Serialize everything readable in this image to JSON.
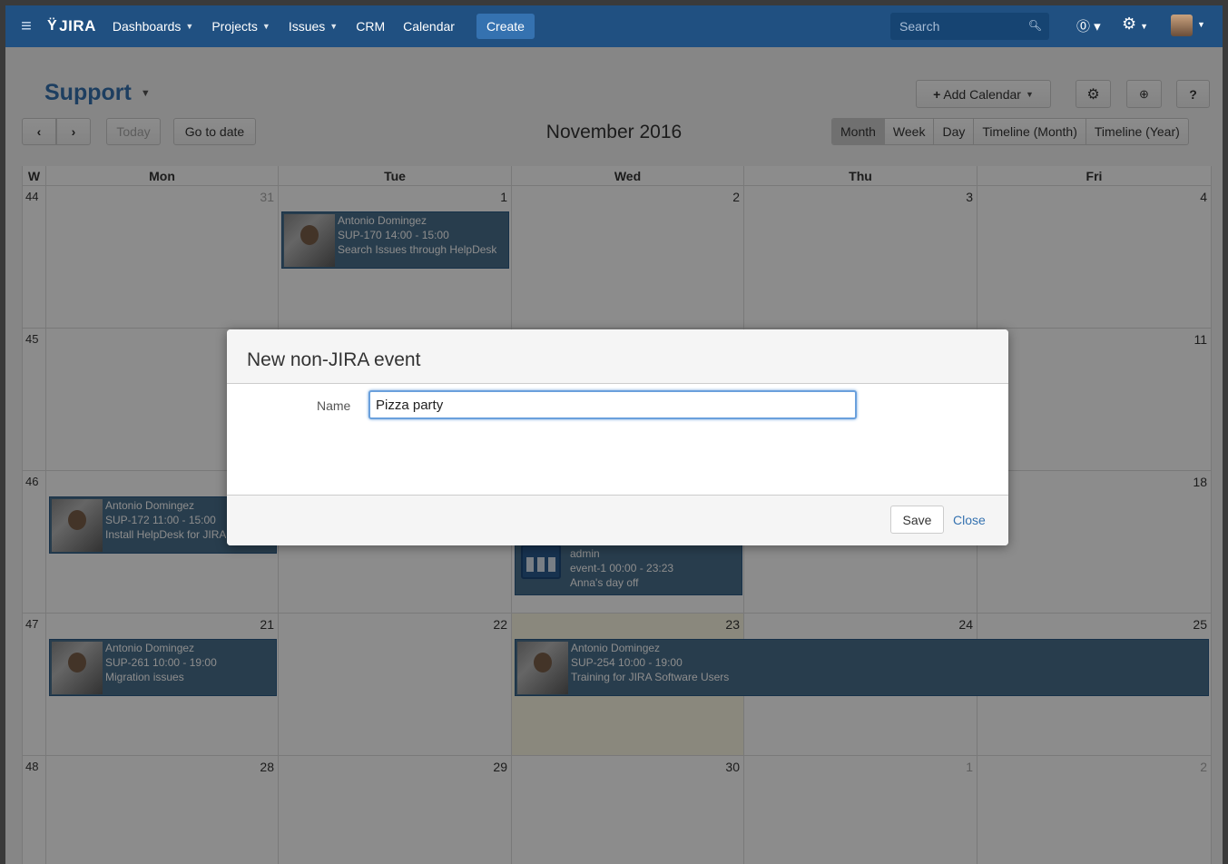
{
  "nav": {
    "menu_icon": "hamburger-icon",
    "logo_text": "JIRA",
    "items": [
      {
        "label": "Dashboards",
        "caret": true
      },
      {
        "label": "Projects",
        "caret": true
      },
      {
        "label": "Issues",
        "caret": true
      },
      {
        "label": "CRM",
        "caret": false
      },
      {
        "label": "Calendar",
        "caret": false
      }
    ],
    "create_label": "Create",
    "search_placeholder": "Search"
  },
  "header": {
    "title": "Support",
    "add_calendar_label": "Add Calendar",
    "help_label": "?",
    "today_label": "Today",
    "go_to_date_label": "Go to date",
    "month_title": "November 2016",
    "views": [
      "Month",
      "Week",
      "Day",
      "Timeline (Month)",
      "Timeline (Year)"
    ],
    "active_view": "Month"
  },
  "calendar": {
    "week_col_label": "W",
    "days": [
      "Mon",
      "Tue",
      "Wed",
      "Thu",
      "Fri"
    ],
    "weeks": [
      {
        "week": "44",
        "dates": [
          "31",
          "1",
          "2",
          "3",
          "4"
        ]
      },
      {
        "week": "45",
        "dates": [
          "",
          "",
          "",
          "",
          "11"
        ]
      },
      {
        "week": "46",
        "dates": [
          "",
          "",
          "",
          "",
          "18"
        ]
      },
      {
        "week": "47",
        "dates": [
          "21",
          "22",
          "23",
          "24",
          "25"
        ]
      },
      {
        "week": "48",
        "dates": [
          "28",
          "29",
          "30",
          "1",
          "2"
        ]
      }
    ],
    "today_date": "23",
    "events": [
      {
        "who": "Antonio Domingez",
        "line2": "SUP-170  14:00 - 15:00",
        "line3": "Search Issues through HelpDesk"
      },
      {
        "who": "Antonio Domingez",
        "line2": "SUP-172  11:00 - 15:00",
        "line3": "Install HelpDesk for JIRA"
      },
      {
        "who": "admin",
        "line2": "event-1  00:00 - 23:23",
        "line3": "Anna's day off"
      },
      {
        "who": "Antonio Domingez",
        "line2": "SUP-261  10:00 - 19:00",
        "line3": "Migration issues"
      },
      {
        "who": "Antonio Domingez",
        "line2": "SUP-254  10:00 - 19:00",
        "line3": "Training for JIRA Software Users"
      }
    ]
  },
  "dialog": {
    "title": "New non-JIRA event",
    "name_label": "Name",
    "name_value": "Pizza party",
    "save_label": "Save",
    "close_label": "Close"
  }
}
